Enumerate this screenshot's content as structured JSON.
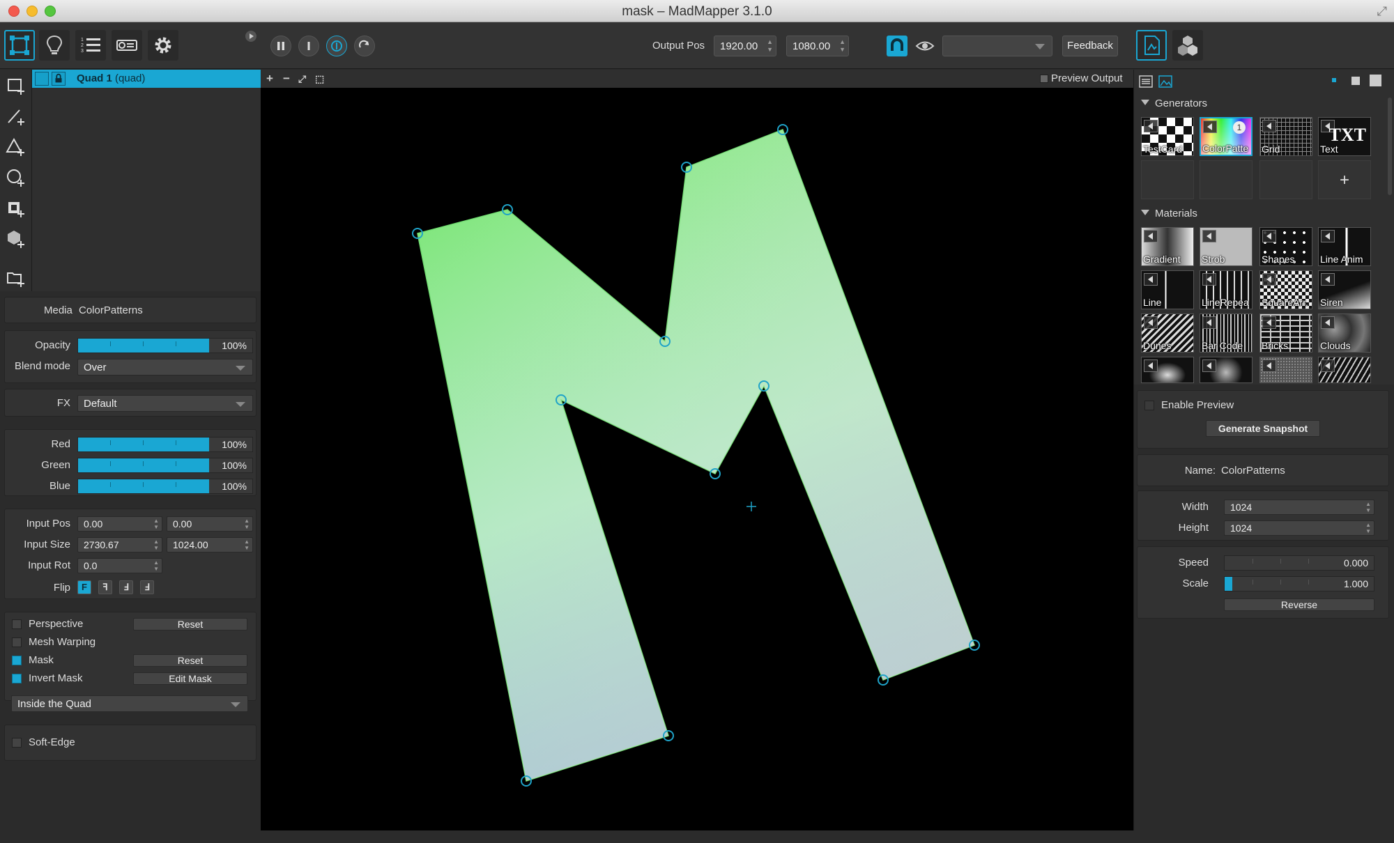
{
  "window": {
    "title": "mask – MadMapper 3.1.0"
  },
  "toolbar": {
    "output_pos_label": "Output Pos",
    "output_x": "1920.00",
    "output_y": "1080.00",
    "dropdown_value": "",
    "feedback_label": "Feedback"
  },
  "surfaces": {
    "items": [
      {
        "name": "Quad 1",
        "type": "(quad)"
      }
    ]
  },
  "inspector": {
    "media_label": "Media",
    "media_value": "ColorPatterns",
    "opacity_label": "Opacity",
    "opacity_value": "100%",
    "opacity_level": 1.0,
    "blend_label": "Blend mode",
    "blend_value": "Over",
    "fx_label": "FX",
    "fx_value": "Default",
    "red_label": "Red",
    "red_value": "100%",
    "red_level": 1.0,
    "green_label": "Green",
    "green_value": "100%",
    "green_level": 1.0,
    "blue_label": "Blue",
    "blue_value": "100%",
    "blue_level": 1.0,
    "input_pos_label": "Input Pos",
    "input_pos_x": "0.00",
    "input_pos_y": "0.00",
    "input_size_label": "Input Size",
    "input_size_w": "2730.67",
    "input_size_h": "1024.00",
    "input_rot_label": "Input Rot",
    "input_rot": "0.0",
    "flip_label": "Flip",
    "flip_glyphs": [
      "F",
      "ꟻ",
      "Ⅎ",
      "ꓞ"
    ],
    "perspective_label": "Perspective",
    "perspective_checked": false,
    "perspective_reset": "Reset",
    "mesh_label": "Mesh Warping",
    "mesh_checked": false,
    "mask_label": "Mask",
    "mask_checked": true,
    "mask_reset": "Reset",
    "invert_label": "Invert Mask",
    "invert_checked": true,
    "edit_mask": "Edit Mask",
    "mask_mode": "Inside the Quad",
    "softedge_label": "Soft-Edge",
    "softedge_checked": false
  },
  "canvas": {
    "preview_output_label": "Preview Output",
    "colors": {
      "top": "#72e56a",
      "mid": "#9fe6b4",
      "bottom": "#7fa8c8",
      "right": "#d0d8d0"
    }
  },
  "library": {
    "generators_label": "Generators",
    "generators": [
      {
        "name": "TestCard",
        "icon": "testcard-icon"
      },
      {
        "name": "ColorPatte",
        "icon": "colorpatterns-icon",
        "selected": true,
        "badge": "1"
      },
      {
        "name": "Grid",
        "icon": "grid-icon"
      },
      {
        "name": "Text",
        "icon": "text-icon",
        "glyph": "TXT"
      }
    ],
    "add_label": "+",
    "materials_label": "Materials",
    "materials": [
      {
        "name": "Gradient"
      },
      {
        "name": "Strob"
      },
      {
        "name": "Shapes"
      },
      {
        "name": "Line Anim"
      },
      {
        "name": "Line"
      },
      {
        "name": "LineRepea"
      },
      {
        "name": "SquareArr."
      },
      {
        "name": "Siren"
      },
      {
        "name": "Dunes"
      },
      {
        "name": "Bar Code"
      },
      {
        "name": "Bricks"
      },
      {
        "name": "Clouds"
      },
      {
        "name": ""
      },
      {
        "name": ""
      },
      {
        "name": ""
      },
      {
        "name": ""
      }
    ]
  },
  "properties": {
    "enable_preview_label": "Enable Preview",
    "generate_snapshot_label": "Generate Snapshot",
    "name_label": "Name:",
    "name_value": "ColorPatterns",
    "width_label": "Width",
    "width_value": "1024",
    "height_label": "Height",
    "height_value": "1024",
    "speed_label": "Speed",
    "speed_value": "0.000",
    "speed_level": 0.0,
    "scale_label": "Scale",
    "scale_value": "1.000",
    "scale_level": 0.07,
    "reverse_label": "Reverse"
  }
}
